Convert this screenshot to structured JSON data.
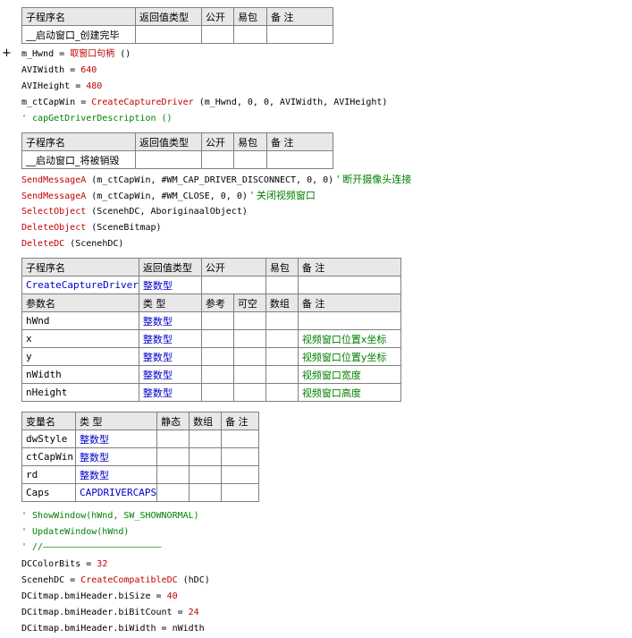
{
  "header_cols": [
    "子程序名",
    "返回值类型",
    "公开",
    "易包",
    "备 注"
  ],
  "param_cols": [
    "参数名",
    "类 型",
    "参考",
    "可空",
    "数组",
    "备 注"
  ],
  "var_cols": [
    "变量名",
    "类 型",
    "静态",
    "数组",
    "备 注"
  ],
  "sub1": {
    "name": "__启动窗口_创建完毕"
  },
  "expand_icon": "+",
  "code1": [
    {
      "a": "m_Hwnd = ",
      "b": "取窗口句柄",
      "c": " ()"
    },
    {
      "a": "AVIWidth = ",
      "b": "640",
      "c": ""
    },
    {
      "a": "AVIHeight = ",
      "b": "480",
      "c": ""
    },
    {
      "a": "m_ctCapWin = ",
      "b": "CreateCaptureDriver",
      "c": " (m_Hwnd, 0, 0, AVIWidth, AVIHeight)"
    }
  ],
  "comment1": "' capGetDriverDescription ()",
  "sub2": {
    "name": "__启动窗口_将被销毁"
  },
  "code2": [
    {
      "f": "SendMessageA",
      "args": " (m_ctCapWin, #WM_CAP_DRIVER_DISCONNECT, 0, 0)",
      "cm": "  ' 断开摄像头连接"
    },
    {
      "f": "SendMessageA",
      "args": " (m_ctCapWin, #WM_CLOSE, 0, 0)",
      "cm": "  ' 关闭视频窗口"
    },
    {
      "f": "SelectObject",
      "args": " (ScenehDC, AboriginaalObject)",
      "cm": ""
    },
    {
      "f": "DeleteObject",
      "args": " (SceneBitmap)",
      "cm": ""
    },
    {
      "f": "DeleteDC",
      "args": " (ScenehDC)",
      "cm": ""
    }
  ],
  "sub3": {
    "name": "CreateCaptureDriver",
    "ret": "整数型"
  },
  "params": [
    {
      "name": "hWnd",
      "type": "整数型",
      "note": ""
    },
    {
      "name": "x",
      "type": "整数型",
      "note": "视频窗口位置x坐标"
    },
    {
      "name": "y",
      "type": "整数型",
      "note": "视频窗口位置y坐标"
    },
    {
      "name": "nWidth",
      "type": "整数型",
      "note": "视频窗口宽度"
    },
    {
      "name": "nHeight",
      "type": "整数型",
      "note": "视频窗口高度"
    }
  ],
  "vars": [
    {
      "name": "dwStyle",
      "type": "整数型"
    },
    {
      "name": "ctCapWin",
      "type": "整数型"
    },
    {
      "name": "rd",
      "type": "整数型"
    },
    {
      "name": "Caps",
      "type": "CAPDRIVERCAPS"
    }
  ],
  "comments3": [
    "' ShowWindow(hWnd, SW_SHOWNORMAL)",
    "' UpdateWindow(hWnd)",
    "' //——————————————————————"
  ],
  "code3": [
    {
      "a": "DCColorBits = ",
      "b": "32",
      "c": ""
    },
    {
      "a": "ScenehDC = ",
      "b": "CreateCompatibleDC",
      "c": " (hDC)"
    },
    {
      "a": "DCitmap.bmiHeader.biSize = ",
      "b": "40",
      "c": ""
    },
    {
      "a": "DCitmap.bmiHeader.biBitCount = ",
      "b": "24",
      "c": ""
    },
    {
      "a": "DCitmap.bmiHeader.biWidth = nWidth",
      "b": "",
      "c": ""
    }
  ]
}
